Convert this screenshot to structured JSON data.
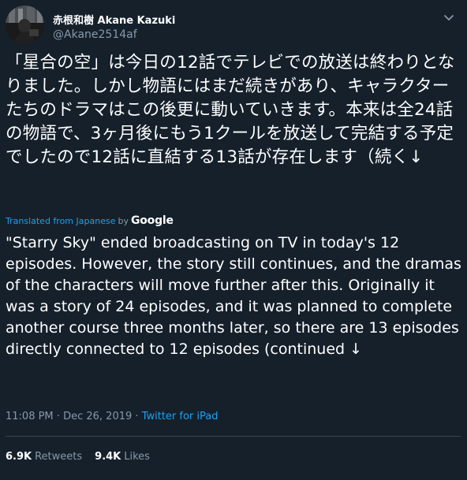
{
  "user": {
    "display_name": "赤根和樹 Akane Kazuki",
    "handle": "@Akane2514af"
  },
  "tweet": {
    "text_original": "「星合の空」は今日の12話でテレビでの放送は終わりとなりました。しかし物語にはまだ続きがあり、キャラクターたちのドラマはこの後更に動いていきます。本来は全24話の物語で、3ヶ月後にもう1クールを放送して完結する予定でしたので12話に直結する13話が存在します（続く↓",
    "translated_label": "Translated from Japanese",
    "translated_by": "by",
    "translation_provider": "Google",
    "text_translated": "\"Starry Sky\" ended broadcasting on TV in today's 12 episodes. However, the story still continues, and the dramas of the characters will move further after this. Originally it was a story of 24 episodes, and it was planned to complete another course three months later, so there are 13 episodes directly connected to 12 episodes (continued ↓",
    "time": "11:08 PM",
    "separator": "·",
    "date": "Dec 26, 2019",
    "source": "Twitter for iPad"
  },
  "stats": {
    "retweets_count": "6.9K",
    "retweets_label": "Retweets",
    "likes_count": "9.4K",
    "likes_label": "Likes"
  },
  "colors": {
    "background": "#15202b",
    "text": "#ffffff",
    "secondary": "#8899a6",
    "accent": "#1da1f2",
    "divider": "#38444d"
  },
  "icons": {
    "more": "chevron-down-icon"
  }
}
